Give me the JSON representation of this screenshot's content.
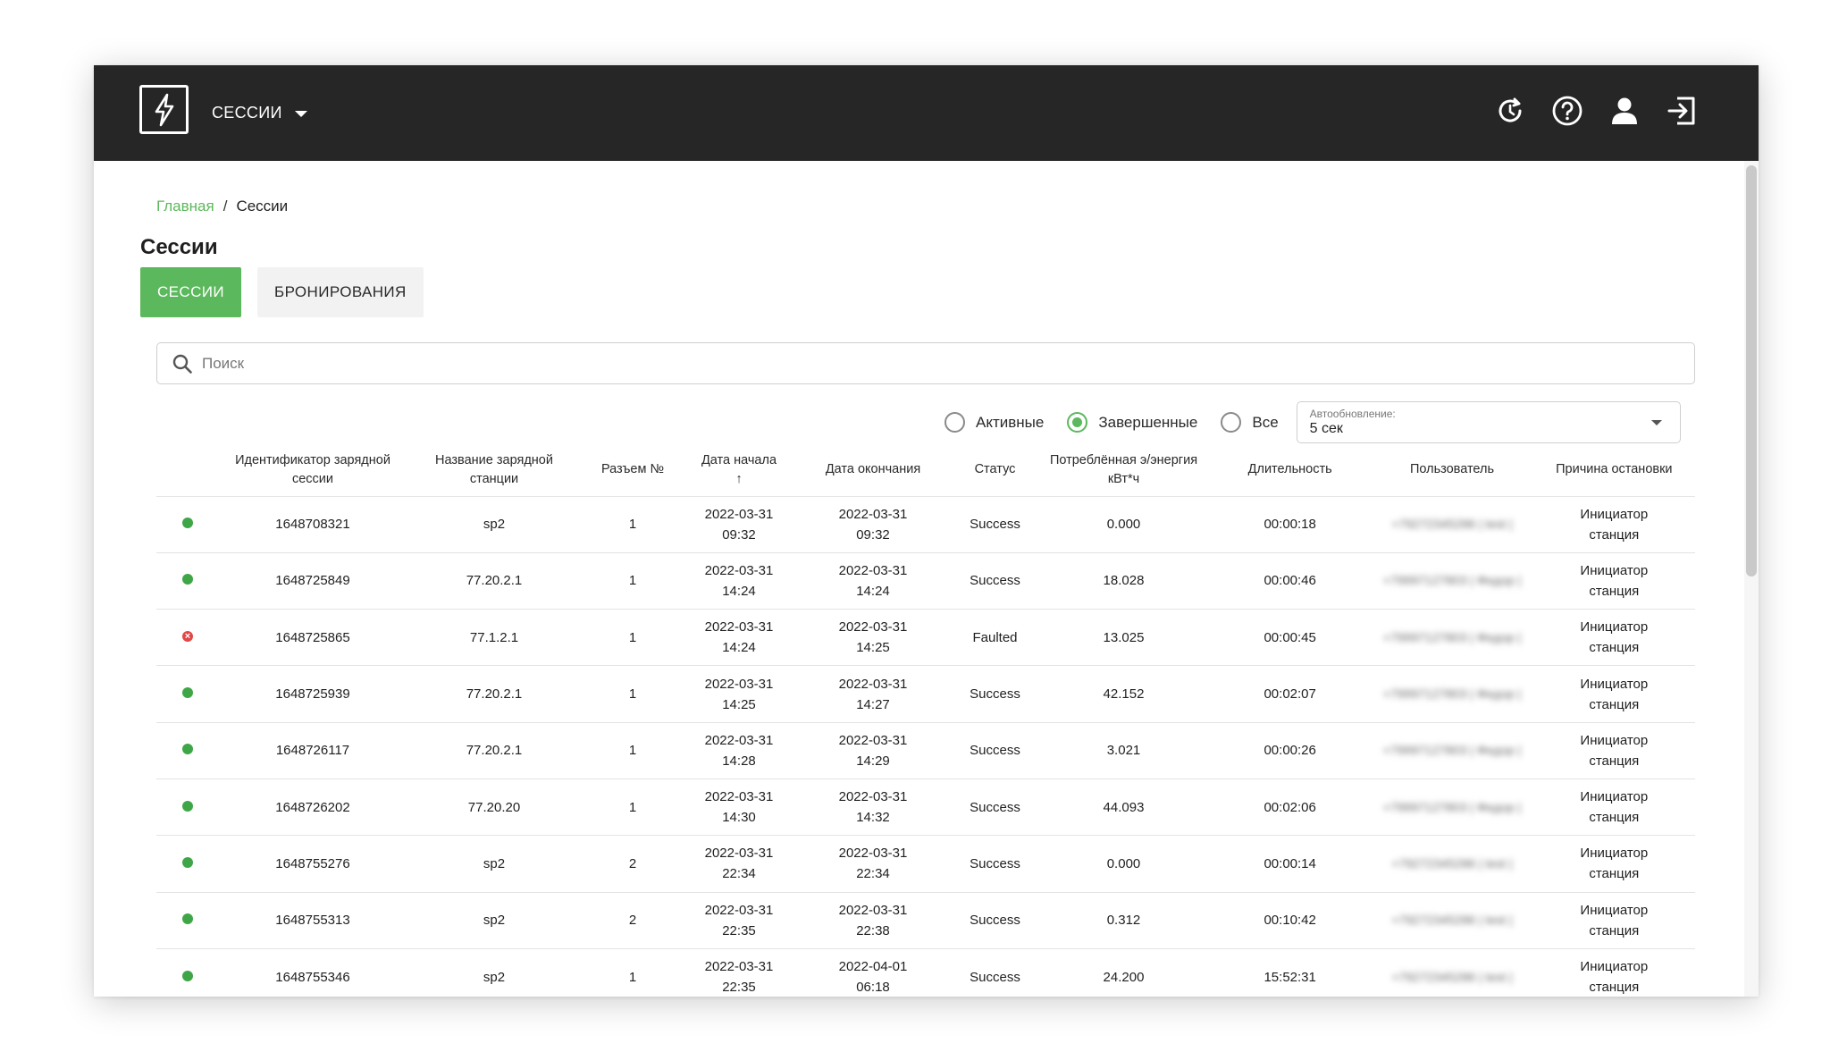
{
  "header": {
    "menu_label": "СЕССИИ",
    "icons": [
      "lightning-logo-icon",
      "refresh-clock-icon",
      "help-icon",
      "user-icon",
      "logout-icon"
    ]
  },
  "breadcrumb": {
    "home": "Главная",
    "separator": "/",
    "current": "Сессии"
  },
  "page": {
    "title": "Сессии"
  },
  "tabs": [
    {
      "label": "СЕССИИ",
      "active": true
    },
    {
      "label": "БРОНИРОВАНИЯ",
      "active": false
    }
  ],
  "search": {
    "placeholder": "Поиск",
    "value": ""
  },
  "filters": {
    "options": [
      {
        "label": "Активные",
        "checked": false
      },
      {
        "label": "Завершенные",
        "checked": true
      },
      {
        "label": "Все",
        "checked": false
      }
    ],
    "autoupdate": {
      "label": "Автообновление:",
      "value": "5 сек"
    }
  },
  "table": {
    "headers": {
      "session_id": "Идентификатор зарядной сессии",
      "station_name": "Название зарядной станции",
      "connector": "Разъем №",
      "start_date": "Дата начала",
      "start_sort": "↑",
      "end_date": "Дата окончания",
      "status": "Статус",
      "energy": "Потреблённая э/энергия кВт*ч",
      "duration": "Длительность",
      "user": "Пользователь",
      "stop_reason": "Причина остановки"
    },
    "rows": [
      {
        "state": "ok",
        "id": "1648708321",
        "station": "sp2",
        "connector": "1",
        "start_d": "2022-03-31",
        "start_t": "09:32",
        "end_d": "2022-03-31",
        "end_t": "09:32",
        "status": "Success",
        "energy": "0.000",
        "duration": "00:00:18",
        "user": "+79272345286 | test |",
        "reason_1": "Инициатор",
        "reason_2": "станция"
      },
      {
        "state": "ok",
        "id": "1648725849",
        "station": "77.20.2.1",
        "connector": "1",
        "start_d": "2022-03-31",
        "start_t": "14:24",
        "end_d": "2022-03-31",
        "end_t": "14:24",
        "status": "Success",
        "energy": "18.028",
        "duration": "00:00:46",
        "user": "+79997127803 | Федор |",
        "reason_1": "Инициатор",
        "reason_2": "станция"
      },
      {
        "state": "err",
        "id": "1648725865",
        "station": "77.1.2.1",
        "connector": "1",
        "start_d": "2022-03-31",
        "start_t": "14:24",
        "end_d": "2022-03-31",
        "end_t": "14:25",
        "status": "Faulted",
        "energy": "13.025",
        "duration": "00:00:45",
        "user": "+79997127803 | Федор |",
        "reason_1": "Инициатор",
        "reason_2": "станция"
      },
      {
        "state": "ok",
        "id": "1648725939",
        "station": "77.20.2.1",
        "connector": "1",
        "start_d": "2022-03-31",
        "start_t": "14:25",
        "end_d": "2022-03-31",
        "end_t": "14:27",
        "status": "Success",
        "energy": "42.152",
        "duration": "00:02:07",
        "user": "+79997127803 | Федор |",
        "reason_1": "Инициатор",
        "reason_2": "станция"
      },
      {
        "state": "ok",
        "id": "1648726117",
        "station": "77.20.2.1",
        "connector": "1",
        "start_d": "2022-03-31",
        "start_t": "14:28",
        "end_d": "2022-03-31",
        "end_t": "14:29",
        "status": "Success",
        "energy": "3.021",
        "duration": "00:00:26",
        "user": "+79997127803 | Федор |",
        "reason_1": "Инициатор",
        "reason_2": "станция"
      },
      {
        "state": "ok",
        "id": "1648726202",
        "station": "77.20.20",
        "connector": "1",
        "start_d": "2022-03-31",
        "start_t": "14:30",
        "end_d": "2022-03-31",
        "end_t": "14:32",
        "status": "Success",
        "energy": "44.093",
        "duration": "00:02:06",
        "user": "+79997127803 | Федор |",
        "reason_1": "Инициатор",
        "reason_2": "станция"
      },
      {
        "state": "ok",
        "id": "1648755276",
        "station": "sp2",
        "connector": "2",
        "start_d": "2022-03-31",
        "start_t": "22:34",
        "end_d": "2022-03-31",
        "end_t": "22:34",
        "status": "Success",
        "energy": "0.000",
        "duration": "00:00:14",
        "user": "+79272345286 | test |",
        "reason_1": "Инициатор",
        "reason_2": "станция"
      },
      {
        "state": "ok",
        "id": "1648755313",
        "station": "sp2",
        "connector": "2",
        "start_d": "2022-03-31",
        "start_t": "22:35",
        "end_d": "2022-03-31",
        "end_t": "22:38",
        "status": "Success",
        "energy": "0.312",
        "duration": "00:10:42",
        "user": "+79272345286 | test |",
        "reason_1": "Инициатор",
        "reason_2": "станция"
      },
      {
        "state": "ok",
        "id": "1648755346",
        "station": "sp2",
        "connector": "1",
        "start_d": "2022-03-31",
        "start_t": "22:35",
        "end_d": "2022-04-01",
        "end_t": "06:18",
        "status": "Success",
        "energy": "24.200",
        "duration": "15:52:31",
        "user": "+79272345286 | test |",
        "reason_1": "Инициатор",
        "reason_2": "станция"
      }
    ]
  },
  "colors": {
    "accent": "#5cb85c",
    "topbar": "#262626",
    "ok": "#3fa648",
    "error": "#e04848"
  }
}
